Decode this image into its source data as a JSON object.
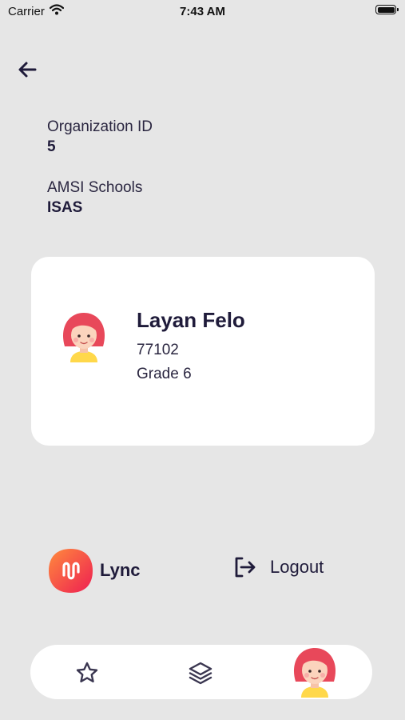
{
  "status_bar": {
    "carrier": "Carrier",
    "time": "7:43 AM"
  },
  "organization": {
    "id_label": "Organization ID",
    "id_value": "5",
    "school_label": "AMSI Schools",
    "school_value": "ISAS"
  },
  "student": {
    "name": "Layan Felo",
    "id": "77102",
    "grade": "Grade 6"
  },
  "footer": {
    "brand": "Lync",
    "logout_label": "Logout"
  },
  "tabs": [
    {
      "icon": "star-icon"
    },
    {
      "icon": "layers-icon"
    },
    {
      "icon": "avatar",
      "selected": true
    }
  ],
  "colors": {
    "background": "#e6e6e6",
    "card": "#ffffff",
    "text_dark": "#1f1b3a",
    "brand_gradient": [
      "#ff8a3d",
      "#ee1f52"
    ],
    "avatar_hair": "#e8485a",
    "avatar_shirt": "#ffd84a"
  }
}
